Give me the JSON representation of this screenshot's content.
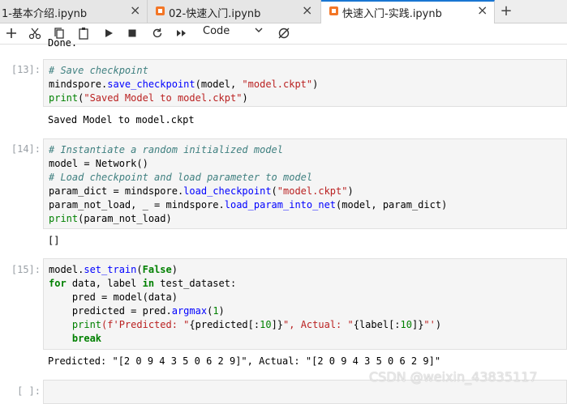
{
  "tabs": [
    {
      "label": "1-基本介绍.ipynb",
      "close": "×"
    },
    {
      "label": "02-快速入门.ipynb",
      "close": "×"
    },
    {
      "label": "快速入门-实践.ipynb",
      "close": "×"
    }
  ],
  "new_tab": "+",
  "toolbar": {
    "cell_type": "Code",
    "icons": [
      "plus-icon",
      "cut-icon",
      "copy-icon",
      "paste-icon",
      "run-icon",
      "stop-icon",
      "restart-icon",
      "fast-forward-icon",
      "kernel-icon"
    ]
  },
  "top_output": "Done.",
  "cells": [
    {
      "prompt": "[13]:",
      "lines": [
        [
          {
            "t": "# Save checkpoint",
            "c": "cm"
          }
        ],
        [
          {
            "t": "mindspore.",
            "c": ""
          },
          {
            "t": "save_checkpoint",
            "c": "fn"
          },
          {
            "t": "(model, ",
            "c": ""
          },
          {
            "t": "\"model.ckpt\"",
            "c": "str"
          },
          {
            "t": ")",
            "c": ""
          }
        ],
        [
          {
            "t": "print",
            "c": "bi"
          },
          {
            "t": "(",
            "c": ""
          },
          {
            "t": "\"Saved Model to model.ckpt\"",
            "c": "str"
          },
          {
            "t": ")",
            "c": ""
          }
        ]
      ],
      "output": "Saved Model to model.ckpt"
    },
    {
      "prompt": "[14]:",
      "lines": [
        [
          {
            "t": "# Instantiate a random initialized model",
            "c": "cm"
          }
        ],
        [
          {
            "t": "model = Network()",
            "c": ""
          }
        ],
        [
          {
            "t": "# Load checkpoint and load parameter to model",
            "c": "cm"
          }
        ],
        [
          {
            "t": "param_dict = mindspore.",
            "c": ""
          },
          {
            "t": "load_checkpoint",
            "c": "fn"
          },
          {
            "t": "(",
            "c": ""
          },
          {
            "t": "\"model.ckpt\"",
            "c": "str"
          },
          {
            "t": ")",
            "c": ""
          }
        ],
        [
          {
            "t": "param_not_load, _ = mindspore.",
            "c": ""
          },
          {
            "t": "load_param_into_net",
            "c": "fn"
          },
          {
            "t": "(model, param_dict)",
            "c": ""
          }
        ],
        [
          {
            "t": "print",
            "c": "bi"
          },
          {
            "t": "(param_not_load)",
            "c": ""
          }
        ]
      ],
      "output": "[]"
    },
    {
      "prompt": "[15]:",
      "lines": [
        [
          {
            "t": "model.",
            "c": ""
          },
          {
            "t": "set_train",
            "c": "fn"
          },
          {
            "t": "(",
            "c": ""
          },
          {
            "t": "False",
            "c": "kw"
          },
          {
            "t": ")",
            "c": ""
          }
        ],
        [
          {
            "t": "for",
            "c": "kw"
          },
          {
            "t": " data, label ",
            "c": ""
          },
          {
            "t": "in",
            "c": "kw"
          },
          {
            "t": " test_dataset:",
            "c": ""
          }
        ],
        [
          {
            "t": "    pred = model(data)",
            "c": ""
          }
        ],
        [
          {
            "t": "    predicted = pred.",
            "c": ""
          },
          {
            "t": "argmax",
            "c": "fn"
          },
          {
            "t": "(",
            "c": ""
          },
          {
            "t": "1",
            "c": "num"
          },
          {
            "t": ")",
            "c": ""
          }
        ],
        [
          {
            "t": "    ",
            "c": ""
          },
          {
            "t": "print",
            "c": "bi"
          },
          {
            "t": "(f'Predicted: \"",
            "c": "str"
          },
          {
            "t": "{predicted[:",
            "c": ""
          },
          {
            "t": "10",
            "c": "num"
          },
          {
            "t": "]}",
            "c": ""
          },
          {
            "t": "\", Actual: \"",
            "c": "str"
          },
          {
            "t": "{label[:",
            "c": ""
          },
          {
            "t": "10",
            "c": "num"
          },
          {
            "t": "]}",
            "c": ""
          },
          {
            "t": "\"'",
            "c": "str"
          },
          {
            "t": ")",
            "c": ""
          }
        ],
        [
          {
            "t": "    ",
            "c": ""
          },
          {
            "t": "break",
            "c": "kw"
          }
        ]
      ],
      "output": "Predicted: \"[2 0 9 4 3 5 0 6 2 9]\", Actual: \"[2 0 9 4 3 5 0 6 2 9]\""
    }
  ],
  "next_prompt": "[ ]:",
  "watermark": "CSDN @weixin_43835117"
}
